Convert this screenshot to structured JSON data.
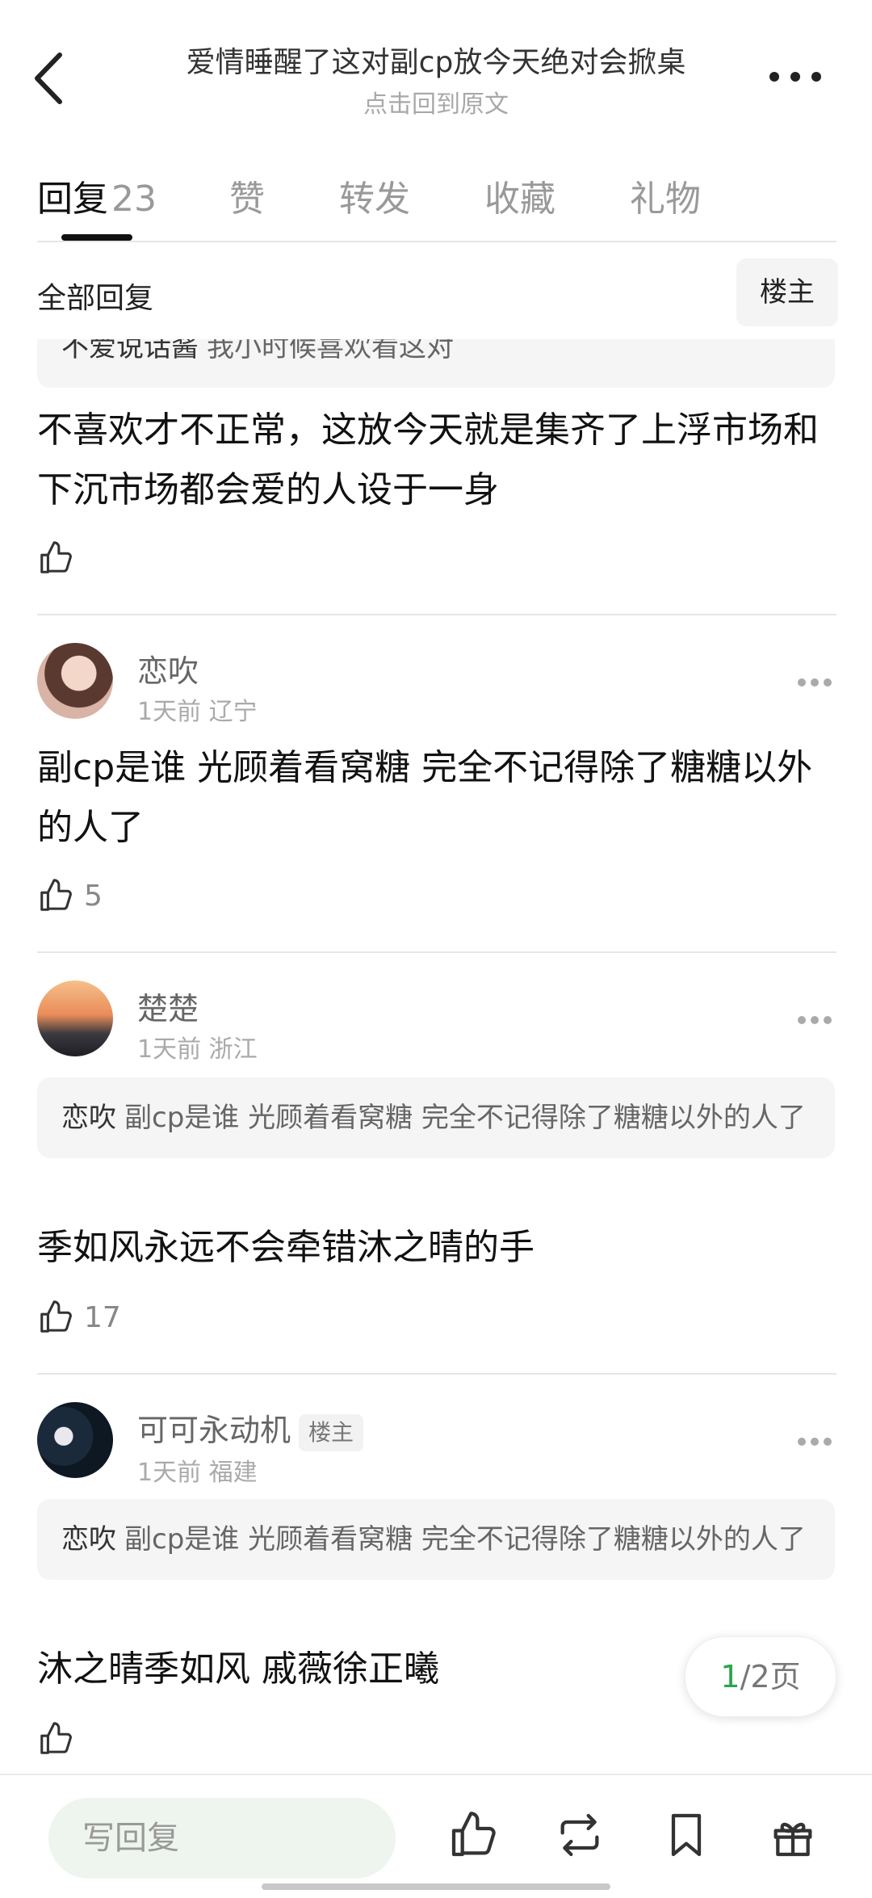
{
  "header": {
    "title": "爱情睡醒了这对副cp放今天绝对会掀桌",
    "subtitle": "点击回到原文",
    "back_icon": "chevron-left-icon",
    "more_icon": "more-horizontal-icon"
  },
  "tabs": [
    {
      "label": "回复",
      "count": "23",
      "active": true
    },
    {
      "label": "赞"
    },
    {
      "label": "转发"
    },
    {
      "label": "收藏"
    },
    {
      "label": "礼物"
    }
  ],
  "filter": {
    "all_label": "全部回复",
    "op_label": "楼主"
  },
  "partial_comment": {
    "quote_name": "不爱说话酱",
    "quote_text": "我小时候喜欢看这对",
    "text": "不喜欢才不正常，这放今天就是集齐了上浮市场和下沉市场都会爱的人设于一身",
    "likes": ""
  },
  "comments": [
    {
      "name": "恋吹",
      "meta": "1天前 辽宁",
      "text": "副cp是谁 光顾着看窝糖 完全不记得除了糖糖以外的人了",
      "likes": "5"
    },
    {
      "name": "楚楚",
      "meta": "1天前 浙江",
      "quote_name": "恋吹",
      "quote_text": "副cp是谁 光顾着看窝糖 完全不记得除了糖糖以外的人了",
      "text": "季如风永远不会牵错沐之晴的手",
      "likes": "17"
    },
    {
      "name": "可可永动机",
      "badge": "楼主",
      "meta": "1天前 福建",
      "quote_name": "恋吹",
      "quote_text": "副cp是谁 光顾着看窝糖 完全不记得除了糖糖以外的人了",
      "text": "沐之晴季如风 戚薇徐正曦",
      "likes": ""
    }
  ],
  "pager": {
    "current": "1",
    "total_suffix": "/2页"
  },
  "bottom_bar": {
    "reply_placeholder": "写回复",
    "icons": [
      "thumbs-up-icon",
      "repost-icon",
      "bookmark-icon",
      "gift-icon"
    ]
  },
  "colors": {
    "accent": "#2aa44a",
    "reply_bg": "#eef5ee"
  }
}
